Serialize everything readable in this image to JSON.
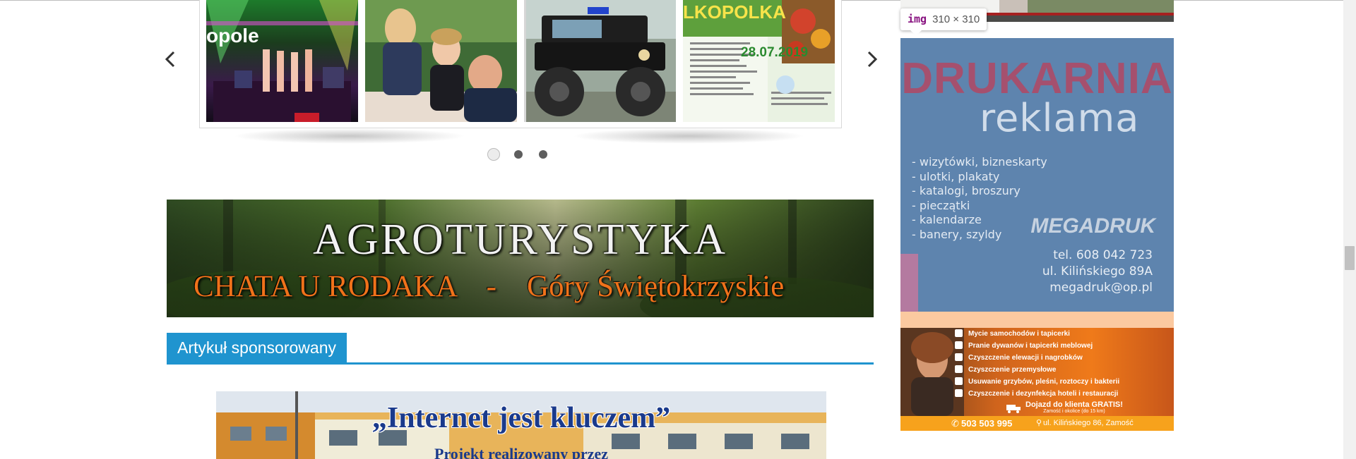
{
  "carousel": {
    "prev_icon": "chevron-left-icon",
    "next_icon": "chevron-right-icon",
    "thumbnails": [
      {
        "text": "opole",
        "accent": "#c25be0"
      },
      {
        "text": "",
        "accent": "#2e6d34"
      },
      {
        "text": "",
        "accent": "#8d8d8d"
      },
      {
        "text": "LKOPOLKA",
        "date": "28.07.2019",
        "accent": "#3b7a21"
      }
    ],
    "dots": 3,
    "active_dot": 0
  },
  "agro_banner": {
    "title": "AGROTURYSTYKA",
    "subtitle": "CHATA U RODAKA    -    Góry Świętokrzyskie"
  },
  "section": {
    "heading": "Artykuł sponsorowany",
    "color": "#1f94cf"
  },
  "article": {
    "title": "„Internet jest kluczem”",
    "subtitle": "Projekt realizowany przez"
  },
  "tooltip": {
    "tag": "img",
    "dims": "310 × 310"
  },
  "ad_drukarnia": {
    "title": "DRUKARNIA",
    "subtitle": "reklama",
    "services": [
      "- wizytówki, bizneskarty",
      "- ulotki, plakaty",
      "- katalogi, broszury",
      "- pieczątki",
      "- kalendarze",
      "- banery, szyldy"
    ],
    "brand": "MEGADRUK",
    "phone": "tel. 608 042 723",
    "address": "ul. Kilińskiego 89A",
    "email": "megadruk@op.pl"
  },
  "ad_cleaning": {
    "services": [
      "Mycie samochodów i tapicerki",
      "Pranie dywanów i tapicerki meblowej",
      "Czyszczenie elewacji i nagrobków",
      "Czyszczenie przemysłowe",
      "Usuwanie grzybów, pleśni, roztoczy i bakterii",
      "Czyszczenie i dezynfekcja hoteli i restauracji"
    ],
    "free_delivery": "Dojazd do klienta GRATIS!",
    "free_delivery_note": "Zamość i okolice (do 15 km)",
    "phone": "503 503 995",
    "address": "ul. Kilińskiego 86, Zamość"
  }
}
